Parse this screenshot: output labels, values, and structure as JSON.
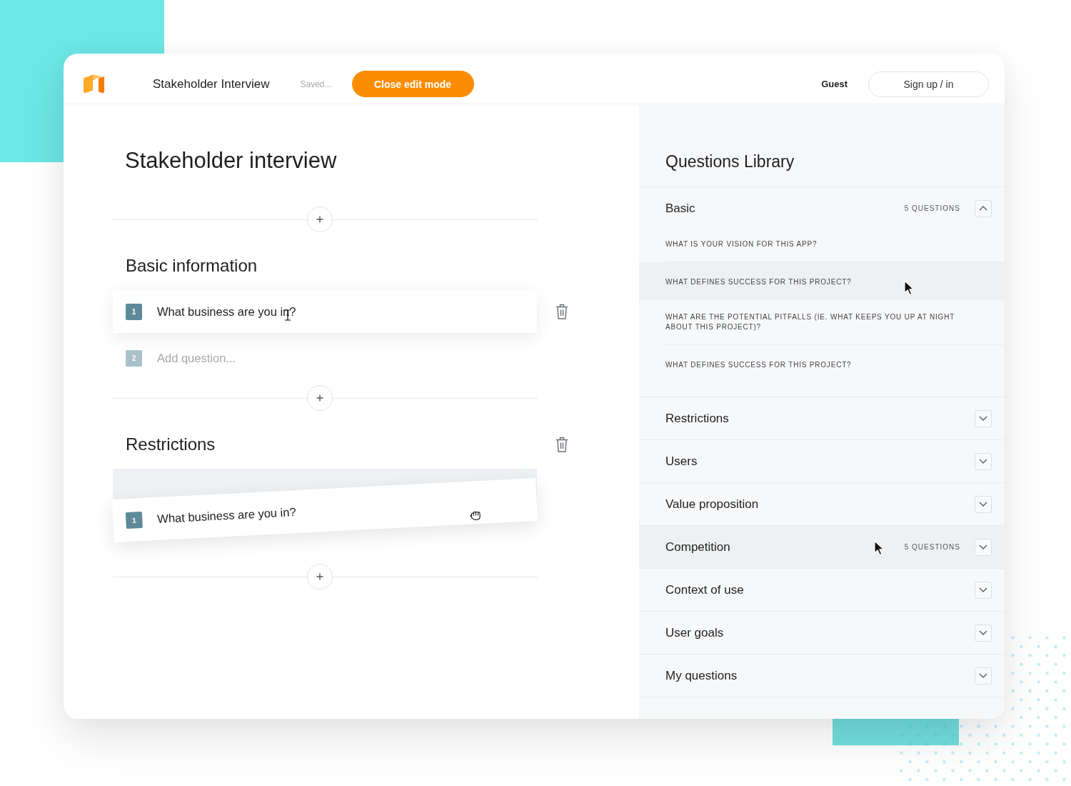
{
  "header": {
    "document_name": "Stakeholder Interview",
    "save_status": "Saved...",
    "close_button": "Close edit mode",
    "user": "Guest",
    "sign_in_button": "Sign up / in"
  },
  "editor": {
    "title": "Stakeholder interview",
    "sections": [
      {
        "title": "Basic information",
        "hovered": false,
        "questions": [
          {
            "kind": "question",
            "number": "1",
            "text": "What business are you in?",
            "hovered": true
          },
          {
            "kind": "new",
            "number": "2",
            "placeholder": "Add question...",
            "hovered": false
          }
        ]
      },
      {
        "title": "Restrictions",
        "hovered": true,
        "questions": [
          {
            "kind": "drop_target"
          }
        ],
        "dragging": {
          "number": "1",
          "text": "What business are you in?"
        }
      }
    ]
  },
  "library": {
    "title": "Questions Library",
    "categories": [
      {
        "name": "Basic",
        "count": "5 QUESTIONS",
        "expanded": true,
        "hovered": false,
        "questions": [
          {
            "text": "WHAT IS YOUR VISION FOR THIS APP?",
            "hovered": false
          },
          {
            "text": "WHAT DEFINES SUCCESS FOR THIS PROJECT?",
            "hovered": true
          },
          {
            "text": "WHAT ARE THE POTENTIAL PITFALLS (IE. WHAT KEEPS YOU UP AT NIGHT ABOUT THIS PROJECT)?",
            "hovered": false
          },
          {
            "text": "WHAT DEFINES SUCCESS FOR THIS PROJECT?",
            "hovered": false
          }
        ]
      },
      {
        "name": "Restrictions",
        "expanded": false,
        "hovered": false
      },
      {
        "name": "Users",
        "expanded": false,
        "hovered": false
      },
      {
        "name": "Value proposition",
        "expanded": false,
        "hovered": false
      },
      {
        "name": "Competition",
        "count": "5 QUESTIONS",
        "expanded": false,
        "hovered": true
      },
      {
        "name": "Context of use",
        "expanded": false,
        "hovered": false
      },
      {
        "name": "User goals",
        "expanded": false,
        "hovered": false
      },
      {
        "name": "My questions",
        "expanded": false,
        "hovered": false
      }
    ]
  }
}
